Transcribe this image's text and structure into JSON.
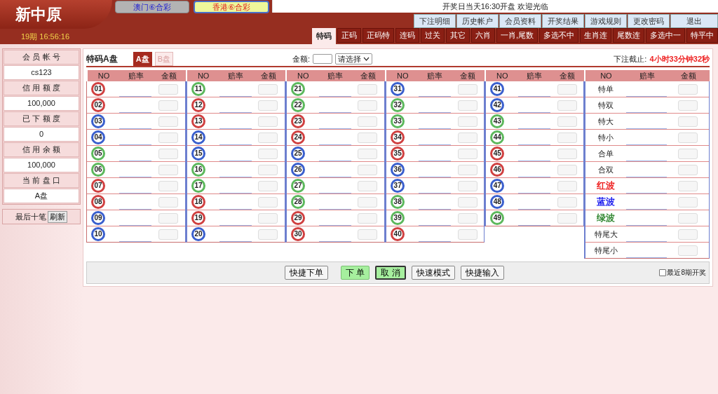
{
  "header": {
    "logo": "新中原",
    "game_tabs": [
      {
        "label": "澳门⑥合彩",
        "selected": false
      },
      {
        "label": "香港⑥合彩",
        "selected": true
      }
    ],
    "notice": "开奖日当天16:30开盘 欢迎光临",
    "links": [
      "下注明细",
      "历史帐户",
      "会员资料",
      "开奖结果",
      "游戏规则",
      "更改密码",
      "退出"
    ],
    "period_time": "19期 16:56:16",
    "nav_tabs": [
      {
        "label": "特码",
        "selected": true
      },
      {
        "label": "正码",
        "selected": false
      },
      {
        "label": "正码特",
        "selected": false
      },
      {
        "label": "连码",
        "selected": false
      },
      {
        "label": "过关",
        "selected": false
      },
      {
        "label": "其它",
        "selected": false
      },
      {
        "label": "六肖",
        "selected": false
      },
      {
        "label": "一肖,尾数",
        "selected": false
      },
      {
        "label": "多选不中",
        "selected": false
      },
      {
        "label": "生肖连",
        "selected": false
      },
      {
        "label": "尾数连",
        "selected": false
      },
      {
        "label": "多选中一",
        "selected": false
      },
      {
        "label": "特平中",
        "selected": false
      }
    ]
  },
  "sidebar": {
    "fields": [
      {
        "label": "会 员 帐 号",
        "value": "cs123"
      },
      {
        "label": "信 用 额 度",
        "value": "100,000"
      },
      {
        "label": "已 下 额 度",
        "value": "0"
      },
      {
        "label": "信 用 余 额",
        "value": "100,000"
      },
      {
        "label": "当 前 盘 口",
        "value": "A盘"
      }
    ],
    "recent": {
      "label": "最后十笔",
      "button": "刷新"
    }
  },
  "panel": {
    "title": "特码A盘",
    "plate_tabs": [
      {
        "label": "A盘",
        "selected": true
      },
      {
        "label": "B盘",
        "selected": false
      }
    ],
    "amount_label": "金额:",
    "amount_select": "请选择",
    "deadline_label": "下注截止:",
    "deadline": "4小时33分钟32秒",
    "columns": [
      {
        "headers": [
          "NO",
          "赔率",
          "金额"
        ],
        "rows": [
          {
            "kind": "ball",
            "label": "01",
            "color": "#d04040"
          },
          {
            "kind": "ball",
            "label": "02",
            "color": "#d04040"
          },
          {
            "kind": "ball",
            "label": "03",
            "color": "#3a5fcd"
          },
          {
            "kind": "ball",
            "label": "04",
            "color": "#3a5fcd"
          },
          {
            "kind": "ball",
            "label": "05",
            "color": "#5cb85c"
          },
          {
            "kind": "ball",
            "label": "06",
            "color": "#5cb85c"
          },
          {
            "kind": "ball",
            "label": "07",
            "color": "#d04040"
          },
          {
            "kind": "ball",
            "label": "08",
            "color": "#d04040"
          },
          {
            "kind": "ball",
            "label": "09",
            "color": "#3a5fcd"
          },
          {
            "kind": "ball",
            "label": "10",
            "color": "#3a5fcd"
          }
        ]
      },
      {
        "headers": [
          "NO",
          "赔率",
          "金额"
        ],
        "rows": [
          {
            "kind": "ball",
            "label": "11",
            "color": "#5cb85c"
          },
          {
            "kind": "ball",
            "label": "12",
            "color": "#d04040"
          },
          {
            "kind": "ball",
            "label": "13",
            "color": "#d04040"
          },
          {
            "kind": "ball",
            "label": "14",
            "color": "#3a5fcd"
          },
          {
            "kind": "ball",
            "label": "15",
            "color": "#3a5fcd"
          },
          {
            "kind": "ball",
            "label": "16",
            "color": "#5cb85c"
          },
          {
            "kind": "ball",
            "label": "17",
            "color": "#5cb85c"
          },
          {
            "kind": "ball",
            "label": "18",
            "color": "#d04040"
          },
          {
            "kind": "ball",
            "label": "19",
            "color": "#d04040"
          },
          {
            "kind": "ball",
            "label": "20",
            "color": "#3a5fcd"
          }
        ]
      },
      {
        "headers": [
          "NO",
          "赔率",
          "金额"
        ],
        "rows": [
          {
            "kind": "ball",
            "label": "21",
            "color": "#5cb85c"
          },
          {
            "kind": "ball",
            "label": "22",
            "color": "#5cb85c"
          },
          {
            "kind": "ball",
            "label": "23",
            "color": "#d04040"
          },
          {
            "kind": "ball",
            "label": "24",
            "color": "#d04040"
          },
          {
            "kind": "ball",
            "label": "25",
            "color": "#3a5fcd"
          },
          {
            "kind": "ball",
            "label": "26",
            "color": "#3a5fcd"
          },
          {
            "kind": "ball",
            "label": "27",
            "color": "#5cb85c"
          },
          {
            "kind": "ball",
            "label": "28",
            "color": "#5cb85c"
          },
          {
            "kind": "ball",
            "label": "29",
            "color": "#d04040"
          },
          {
            "kind": "ball",
            "label": "30",
            "color": "#d04040"
          }
        ]
      },
      {
        "headers": [
          "NO",
          "赔率",
          "金额"
        ],
        "rows": [
          {
            "kind": "ball",
            "label": "31",
            "color": "#3a5fcd"
          },
          {
            "kind": "ball",
            "label": "32",
            "color": "#5cb85c"
          },
          {
            "kind": "ball",
            "label": "33",
            "color": "#5cb85c"
          },
          {
            "kind": "ball",
            "label": "34",
            "color": "#d04040"
          },
          {
            "kind": "ball",
            "label": "35",
            "color": "#d04040"
          },
          {
            "kind": "ball",
            "label": "36",
            "color": "#3a5fcd"
          },
          {
            "kind": "ball",
            "label": "37",
            "color": "#3a5fcd"
          },
          {
            "kind": "ball",
            "label": "38",
            "color": "#5cb85c"
          },
          {
            "kind": "ball",
            "label": "39",
            "color": "#5cb85c"
          },
          {
            "kind": "ball",
            "label": "40",
            "color": "#d04040"
          }
        ]
      },
      {
        "headers": [
          "NO",
          "赔率",
          "金额"
        ],
        "rows": [
          {
            "kind": "ball",
            "label": "41",
            "color": "#3a5fcd"
          },
          {
            "kind": "ball",
            "label": "42",
            "color": "#3a5fcd"
          },
          {
            "kind": "ball",
            "label": "43",
            "color": "#5cb85c"
          },
          {
            "kind": "ball",
            "label": "44",
            "color": "#5cb85c"
          },
          {
            "kind": "ball",
            "label": "45",
            "color": "#d04040"
          },
          {
            "kind": "ball",
            "label": "46",
            "color": "#d04040"
          },
          {
            "kind": "ball",
            "label": "47",
            "color": "#3a5fcd"
          },
          {
            "kind": "ball",
            "label": "48",
            "color": "#3a5fcd"
          },
          {
            "kind": "ball",
            "label": "49",
            "color": "#5cb85c"
          }
        ]
      },
      {
        "headers": [
          "NO",
          "赔率",
          "金额"
        ],
        "rows": [
          {
            "kind": "text",
            "label": "特单"
          },
          {
            "kind": "text",
            "label": "特双"
          },
          {
            "kind": "text",
            "label": "特大"
          },
          {
            "kind": "text",
            "label": "特小"
          },
          {
            "kind": "text",
            "label": "合单"
          },
          {
            "kind": "text",
            "label": "合双"
          },
          {
            "kind": "text",
            "label": "红波",
            "color": "#ee2222"
          },
          {
            "kind": "text",
            "label": "蓝波",
            "color": "#1a1aee"
          },
          {
            "kind": "text",
            "label": "绿波",
            "color": "#338833"
          },
          {
            "kind": "text",
            "label": "特尾大"
          },
          {
            "kind": "text",
            "label": "特尾小"
          }
        ]
      }
    ],
    "buttons": [
      {
        "label": "快捷下单",
        "kind": "plain"
      },
      {
        "label": "下 单",
        "kind": "green"
      },
      {
        "label": "取 消",
        "kind": "green-focus"
      },
      {
        "label": "快速模式",
        "kind": "plain"
      },
      {
        "label": "快捷输入",
        "kind": "plain"
      }
    ],
    "recent_draws": {
      "label": "最近8期开奖",
      "checked": false
    }
  }
}
